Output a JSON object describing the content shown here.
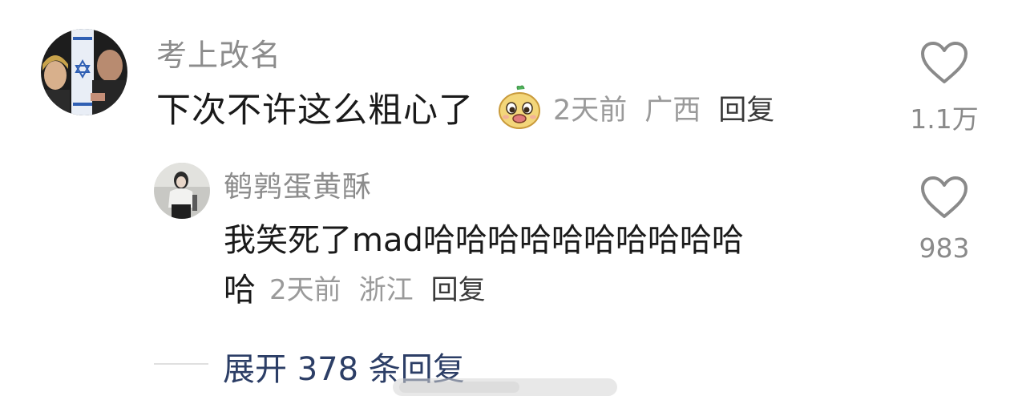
{
  "main_comment": {
    "username": "考上改名",
    "text": "下次不许这么粗心了",
    "emoji": "yellow-face-emoji",
    "time": "2天前",
    "region": "广西",
    "reply_label": "回复",
    "like_count": "1.1万"
  },
  "reply_comment": {
    "username": "鹌鹑蛋黄酥",
    "text_line1": "我笑死了mad哈哈哈哈哈哈哈哈哈哈",
    "text_line2": "哈",
    "time": "2天前",
    "region": "浙江",
    "reply_label": "回复",
    "like_count": "983"
  },
  "expand": {
    "label": "展开 378 条回复"
  },
  "colors": {
    "username": "#8c8c8c",
    "text": "#1a1a1a",
    "meta": "#9a9a9a",
    "expand": "#2c3e66"
  }
}
